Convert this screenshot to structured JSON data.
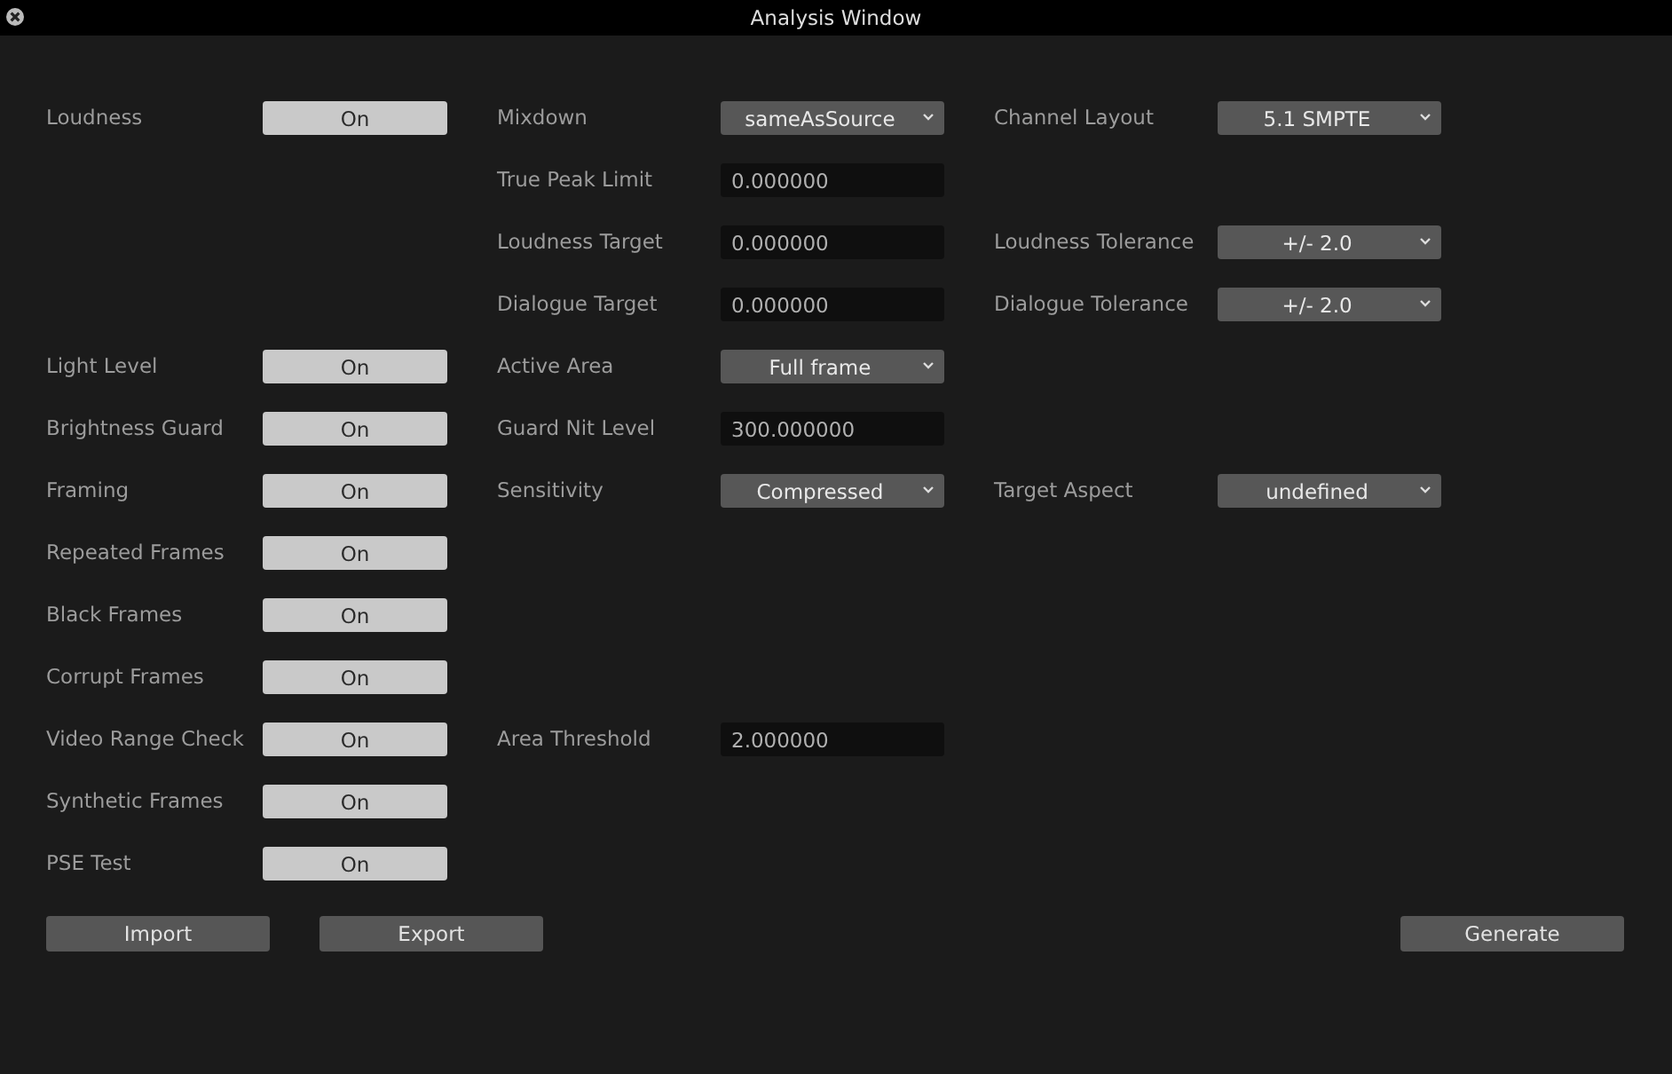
{
  "window": {
    "title": "Analysis Window"
  },
  "rows": [
    {
      "toggle": {
        "label": "Loudness",
        "value": "On",
        "on": true
      },
      "middle": {
        "label": "Mixdown",
        "kind": "dropdown",
        "value": "sameAsSource"
      },
      "right": {
        "label": "Channel Layout",
        "kind": "dropdown",
        "value": "5.1 SMPTE"
      }
    },
    {
      "middle": {
        "label": "True Peak Limit",
        "kind": "field",
        "value": "0.000000"
      }
    },
    {
      "middle": {
        "label": "Loudness Target",
        "kind": "field",
        "value": "0.000000"
      },
      "right": {
        "label": "Loudness Tolerance",
        "kind": "dropdown",
        "value": "+/- 2.0"
      }
    },
    {
      "middle": {
        "label": "Dialogue Target",
        "kind": "field",
        "value": "0.000000"
      },
      "right": {
        "label": "Dialogue Tolerance",
        "kind": "dropdown",
        "value": "+/- 2.0"
      }
    },
    {
      "toggle": {
        "label": "Light Level",
        "value": "On",
        "on": true
      },
      "middle": {
        "label": "Active Area",
        "kind": "dropdown",
        "value": "Full frame"
      }
    },
    {
      "toggle": {
        "label": "Brightness Guard",
        "value": "On",
        "on": true
      },
      "middle": {
        "label": "Guard Nit Level",
        "kind": "field",
        "value": "300.000000"
      }
    },
    {
      "toggle": {
        "label": "Framing",
        "value": "On",
        "on": true
      },
      "middle": {
        "label": "Sensitivity",
        "kind": "dropdown",
        "value": "Compressed"
      },
      "right": {
        "label": "Target Aspect",
        "kind": "dropdown",
        "value": "undefined"
      }
    },
    {
      "toggle": {
        "label": "Repeated Frames",
        "value": "On",
        "on": true
      }
    },
    {
      "toggle": {
        "label": "Black Frames",
        "value": "On",
        "on": true
      }
    },
    {
      "toggle": {
        "label": "Corrupt Frames",
        "value": "On",
        "on": true
      }
    },
    {
      "toggle": {
        "label": "Video Range Check",
        "value": "On",
        "on": true
      },
      "middle": {
        "label": "Area Threshold",
        "kind": "field",
        "value": "2.000000"
      }
    },
    {
      "toggle": {
        "label": "Synthetic Frames",
        "value": "On",
        "on": true
      }
    },
    {
      "toggle": {
        "label": "PSE Test",
        "value": "On",
        "on": true
      }
    }
  ],
  "left_buttons": [
    "Import",
    "Export"
  ],
  "right_buttons": [
    "Generate"
  ]
}
